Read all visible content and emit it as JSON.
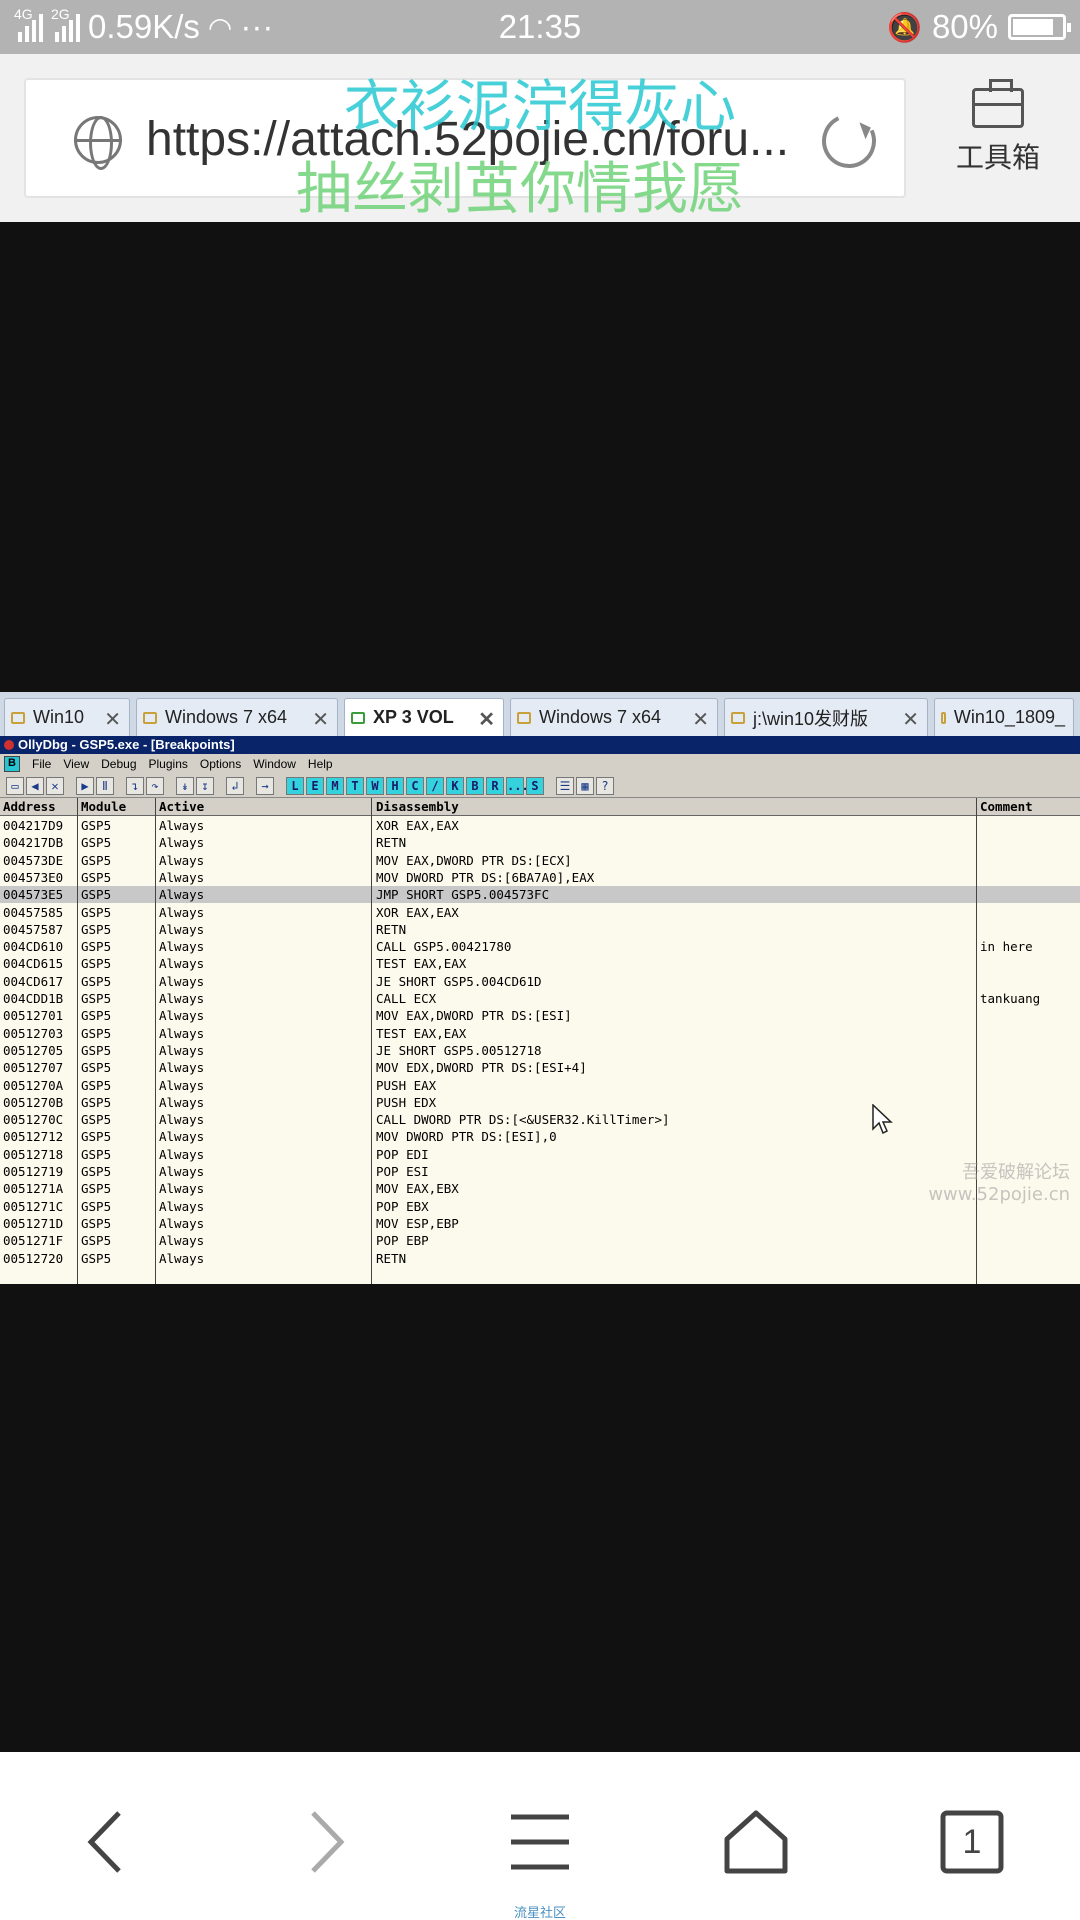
{
  "status_bar": {
    "net1": "4G",
    "net2": "2G",
    "speed": "0.59K/s",
    "more": "···",
    "time": "21:35",
    "battery": "80%",
    "battery_level": 0.8
  },
  "browser": {
    "url": "https://attach.52pojie.cn/foru...",
    "toolbox_label": "工具箱",
    "overlay_line1": "衣衫泥泞得灰心",
    "overlay_line2": "抽丝剥茧你情我愿"
  },
  "tabs": [
    {
      "label": "Win10",
      "active": false
    },
    {
      "label": "Windows 7 x64",
      "active": false
    },
    {
      "label": "XP 3 VOL",
      "active": true
    },
    {
      "label": "Windows 7 x64",
      "active": false
    },
    {
      "label": "j:\\win10发财版",
      "active": false
    },
    {
      "label": "Win10_1809_",
      "active": false
    }
  ],
  "olly": {
    "title": "OllyDbg - GSP5.exe - [Breakpoints]",
    "menu": [
      "File",
      "View",
      "Debug",
      "Plugins",
      "Options",
      "Window",
      "Help"
    ],
    "menu_b": "B",
    "toolbar_letters": [
      "L",
      "E",
      "M",
      "T",
      "W",
      "H",
      "C",
      "/",
      "K",
      "B",
      "R",
      "...",
      "S"
    ],
    "columns": [
      "Address",
      "Module",
      "Active",
      "Disassembly",
      "Comment"
    ],
    "rows": [
      [
        "004217D9",
        "GSP5",
        "Always",
        "XOR EAX,EAX",
        ""
      ],
      [
        "004217DB",
        "GSP5",
        "Always",
        "RETN",
        ""
      ],
      [
        "004573DE",
        "GSP5",
        "Always",
        "MOV EAX,DWORD PTR DS:[ECX]",
        ""
      ],
      [
        "004573E0",
        "GSP5",
        "Always",
        "MOV DWORD PTR DS:[6BA7A0],EAX",
        ""
      ],
      [
        "004573E5",
        "GSP5",
        "Always",
        "JMP SHORT GSP5.004573FC",
        ""
      ],
      [
        "00457585",
        "GSP5",
        "Always",
        "XOR EAX,EAX",
        ""
      ],
      [
        "00457587",
        "GSP5",
        "Always",
        "RETN",
        ""
      ],
      [
        "004CD610",
        "GSP5",
        "Always",
        "CALL GSP5.00421780",
        "in here"
      ],
      [
        "004CD615",
        "GSP5",
        "Always",
        "TEST EAX,EAX",
        ""
      ],
      [
        "004CD617",
        "GSP5",
        "Always",
        "JE SHORT GSP5.004CD61D",
        ""
      ],
      [
        "004CDD1B",
        "GSP5",
        "Always",
        "CALL ECX",
        "tankuang"
      ],
      [
        "00512701",
        "GSP5",
        "Always",
        "MOV EAX,DWORD PTR DS:[ESI]",
        ""
      ],
      [
        "00512703",
        "GSP5",
        "Always",
        "TEST EAX,EAX",
        ""
      ],
      [
        "00512705",
        "GSP5",
        "Always",
        "JE SHORT GSP5.00512718",
        ""
      ],
      [
        "00512707",
        "GSP5",
        "Always",
        "MOV EDX,DWORD PTR DS:[ESI+4]",
        ""
      ],
      [
        "0051270A",
        "GSP5",
        "Always",
        "PUSH EAX",
        ""
      ],
      [
        "0051270B",
        "GSP5",
        "Always",
        "PUSH EDX",
        ""
      ],
      [
        "0051270C",
        "GSP5",
        "Always",
        "CALL DWORD PTR DS:[<&USER32.KillTimer>]",
        ""
      ],
      [
        "00512712",
        "GSP5",
        "Always",
        "MOV DWORD PTR DS:[ESI],0",
        ""
      ],
      [
        "00512718",
        "GSP5",
        "Always",
        "POP EDI",
        ""
      ],
      [
        "00512719",
        "GSP5",
        "Always",
        "POP ESI",
        ""
      ],
      [
        "0051271A",
        "GSP5",
        "Always",
        "MOV EAX,EBX",
        ""
      ],
      [
        "0051271C",
        "GSP5",
        "Always",
        "POP EBX",
        ""
      ],
      [
        "0051271D",
        "GSP5",
        "Always",
        "MOV ESP,EBP",
        ""
      ],
      [
        "0051271F",
        "GSP5",
        "Always",
        "POP EBP",
        ""
      ],
      [
        "00512720",
        "GSP5",
        "Always",
        "RETN",
        ""
      ]
    ],
    "selected_row": 4,
    "watermark_line1": "吾爱破解论坛",
    "watermark_line2": "www.52pojie.cn"
  },
  "bottom_nav": {
    "tabs_count": "1",
    "brand": "流星社区"
  }
}
